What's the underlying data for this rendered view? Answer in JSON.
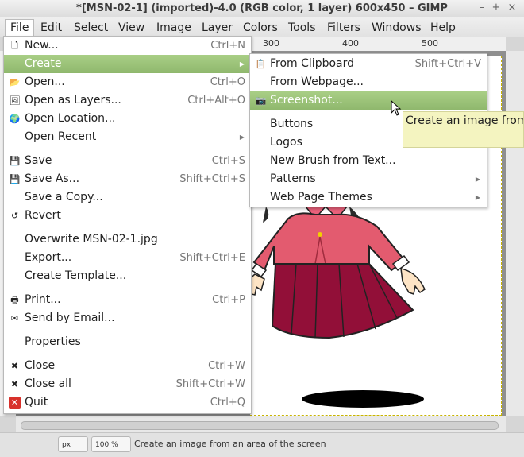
{
  "window": {
    "title": "*[MSN-02-1] (imported)-4.0 (RGB color, 1 layer) 600x450 – GIMP",
    "min": "–",
    "max": "+",
    "close": "×"
  },
  "menubar": [
    "File",
    "Edit",
    "Select",
    "View",
    "Image",
    "Layer",
    "Colors",
    "Tools",
    "Filters",
    "Windows",
    "Help"
  ],
  "ruler": [
    "300",
    "400",
    "500"
  ],
  "file_menu": {
    "new": {
      "label": "New...",
      "accel": "Ctrl+N"
    },
    "create": {
      "label": "Create"
    },
    "open": {
      "label": "Open...",
      "accel": "Ctrl+O"
    },
    "open_layers": {
      "label": "Open as Layers...",
      "accel": "Ctrl+Alt+O"
    },
    "open_location": {
      "label": "Open Location..."
    },
    "open_recent": {
      "label": "Open Recent"
    },
    "save": {
      "label": "Save",
      "accel": "Ctrl+S"
    },
    "save_as": {
      "label": "Save As...",
      "accel": "Shift+Ctrl+S"
    },
    "save_copy": {
      "label": "Save a Copy..."
    },
    "revert": {
      "label": "Revert"
    },
    "overwrite": {
      "label": "Overwrite MSN-02-1.jpg"
    },
    "export": {
      "label": "Export...",
      "accel": "Shift+Ctrl+E"
    },
    "create_template": {
      "label": "Create Template..."
    },
    "print": {
      "label": "Print...",
      "accel": "Ctrl+P"
    },
    "send_email": {
      "label": "Send by Email..."
    },
    "properties": {
      "label": "Properties"
    },
    "close": {
      "label": "Close",
      "accel": "Ctrl+W"
    },
    "close_all": {
      "label": "Close all",
      "accel": "Shift+Ctrl+W"
    },
    "quit": {
      "label": "Quit",
      "accel": "Ctrl+Q"
    }
  },
  "create_menu": {
    "clipboard": {
      "label": "From Clipboard",
      "accel": "Shift+Ctrl+V"
    },
    "webpage": {
      "label": "From Webpage..."
    },
    "screenshot": {
      "label": "Screenshot..."
    },
    "buttons": {
      "label": "Buttons"
    },
    "logos": {
      "label": "Logos"
    },
    "brush": {
      "label": "New Brush from Text..."
    },
    "patterns": {
      "label": "Patterns"
    },
    "themes": {
      "label": "Web Page Themes"
    }
  },
  "tooltip": "Create an image from a",
  "status": {
    "unit": "px",
    "zoom": "100 %",
    "message": "Create an image from an area of the screen"
  },
  "colors": {
    "highlight": "#9bc379",
    "canvas": "#8f8f8f",
    "quit_icon": "#d8312b"
  }
}
